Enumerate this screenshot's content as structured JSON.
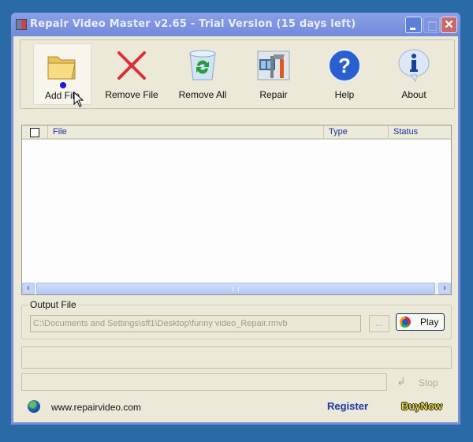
{
  "window": {
    "title": "Repair Video Master v2.65 - Trial Version (15 days left)",
    "controls": {
      "minimize": "minimize",
      "maximize": "maximize",
      "close": "✕"
    }
  },
  "toolbar": {
    "items": [
      {
        "label": "Add File",
        "icon": "folder-icon",
        "active": true
      },
      {
        "label": "Remove File",
        "icon": "red-x-icon"
      },
      {
        "label": "Remove All",
        "icon": "recycle-bin-icon"
      },
      {
        "label": "Repair",
        "icon": "repair-tools-icon"
      },
      {
        "label": "Help",
        "icon": "question-icon"
      },
      {
        "label": "About",
        "icon": "info-icon"
      }
    ]
  },
  "file_list": {
    "columns": [
      "File",
      "Type",
      "Status"
    ],
    "rows": [],
    "scroll_left": "‹",
    "scroll_right": "›"
  },
  "output": {
    "legend": "Output File",
    "path": "C:\\Documents and Settings\\sff1\\Desktop\\funny video_Repair.rmvb",
    "browse_label": "...",
    "play_label": "Play"
  },
  "progress": {
    "stop_label": "Stop"
  },
  "footer": {
    "website": "www.repairvideo.com",
    "register": "Register",
    "buynow": "BuyNow"
  }
}
